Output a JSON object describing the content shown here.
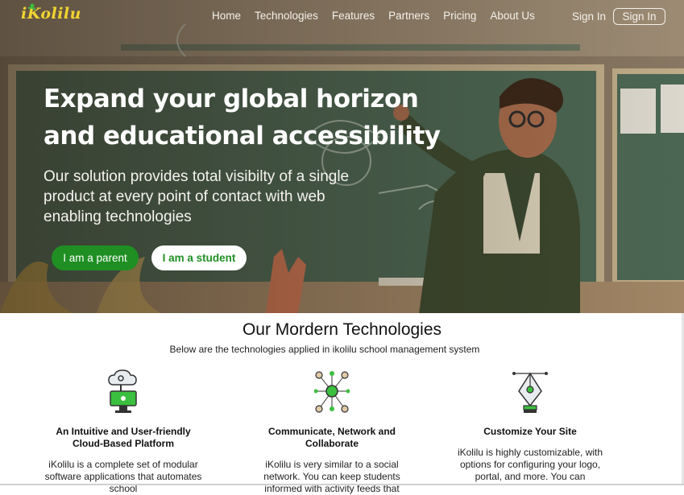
{
  "brand": {
    "name": "iKolilu",
    "color": "#f1d431"
  },
  "nav": {
    "items": [
      "Home",
      "Technologies",
      "Features",
      "Partners",
      "Pricing",
      "About Us"
    ],
    "signin_link": "Sign In",
    "signin_button": "Sign In"
  },
  "hero": {
    "title_line1": "Expand your global horizon",
    "title_line2": "and educational accessibility",
    "subtitle": "Our solution provides total visibilty of a single product at every point of contact with web  enabling technologies",
    "parent_button": "I am a parent",
    "student_button": "I am a student",
    "accent_color": "#1f8f23"
  },
  "tech": {
    "title": "Our Mordern Technologies",
    "subtitle": "Below are the technologies applied in ikolilu school management system",
    "columns": [
      {
        "icon": "cloud-computer-icon",
        "title": "An Intuitive and User-friendly Cloud-Based Platform",
        "desc": "iKolilu is a complete set of modular software applications that automates school"
      },
      {
        "icon": "network-icon",
        "title": "Communicate, Network and Collaborate",
        "desc": "iKolilu is very similar to a social network. You can keep students informed with activity feeds that"
      },
      {
        "icon": "pen-tool-icon",
        "title": "Customize Your Site",
        "desc": "iKolilu is highly customizable, with options for configuring your logo, portal, and more. You can"
      }
    ]
  }
}
